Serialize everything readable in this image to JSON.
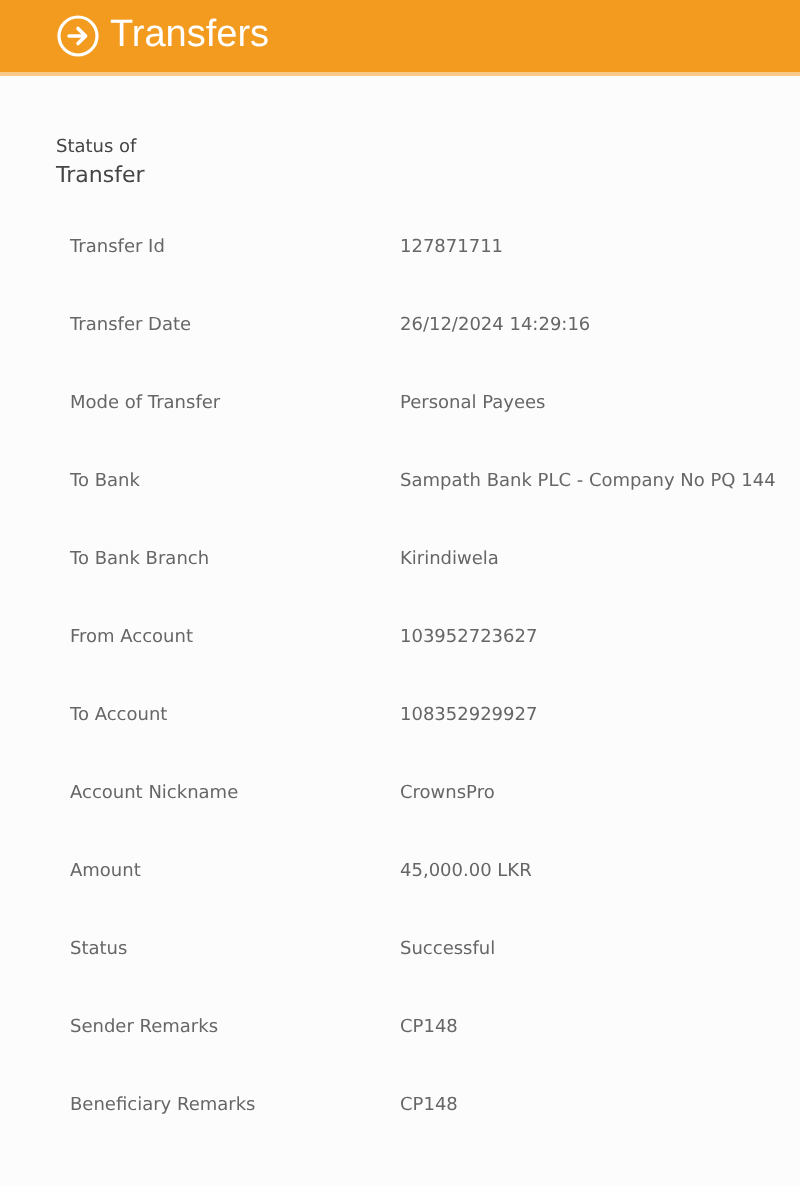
{
  "header": {
    "title": "Transfers"
  },
  "section": {
    "title_lines": [
      "Status of",
      "Transfer"
    ]
  },
  "details": [
    {
      "label": "Transfer Id",
      "value": "127871711"
    },
    {
      "label": "Transfer Date",
      "value": "26/12/2024 14:29:16"
    },
    {
      "label": "Mode of Transfer",
      "value": "Personal Payees"
    },
    {
      "label": "To Bank",
      "value": "Sampath Bank PLC - Company No PQ 144"
    },
    {
      "label": "To Bank Branch",
      "value": "Kirindiwela"
    },
    {
      "label": "From Account",
      "value": "103952723627"
    },
    {
      "label": "To Account",
      "value": "108352929927"
    },
    {
      "label": "Account Nickname",
      "value": "CrownsPro"
    },
    {
      "label": "Amount",
      "value": "45,000.00 LKR"
    },
    {
      "label": "Status",
      "value": "Successful"
    },
    {
      "label": "Sender Remarks",
      "value": "CP148"
    },
    {
      "label": "Beneficiary Remarks",
      "value": "CP148"
    }
  ]
}
